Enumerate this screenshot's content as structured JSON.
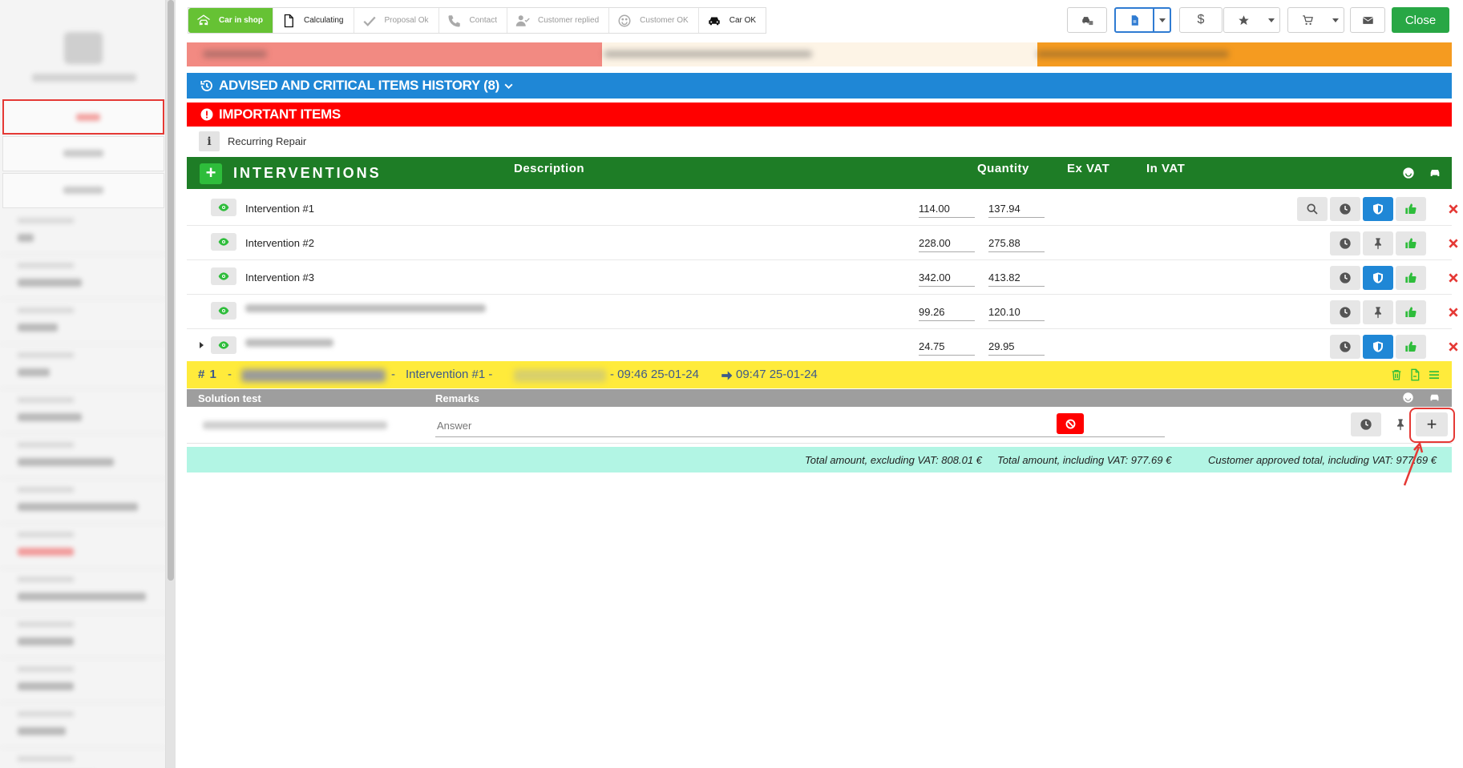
{
  "steps": [
    {
      "label": "Car in shop",
      "state": "done",
      "icon": "car-garage-icon"
    },
    {
      "label": "Calculating",
      "state": "current",
      "icon": "document-icon"
    },
    {
      "label": "Proposal Ok",
      "state": "muted",
      "icon": "check-icon"
    },
    {
      "label": "Contact",
      "state": "muted",
      "icon": "phone-icon"
    },
    {
      "label": "Customer replied",
      "state": "muted",
      "icon": "user-check-icon"
    },
    {
      "label": "Customer OK",
      "state": "muted",
      "icon": "smile-icon"
    },
    {
      "label": "Car OK",
      "state": "current",
      "icon": "car-icon"
    }
  ],
  "toolbar": {
    "close_label": "Close",
    "dollar_label": "$"
  },
  "sections": {
    "history_label": "ADVISED AND CRITICAL ITEMS HISTORY (8)",
    "important_label": "IMPORTANT ITEMS",
    "recurring_label": "Recurring Repair",
    "info_label": "i"
  },
  "interventions": {
    "title": "INTERVENTIONS",
    "add_label": "+",
    "col_description": "Description",
    "col_quantity": "Quantity",
    "col_exvat": "Ex VAT",
    "col_invat": "In VAT",
    "rows": [
      {
        "name": "Intervention #1",
        "ex_vat": "114.00",
        "in_vat": "137.94",
        "actions": [
          "search",
          "clock",
          "shield",
          "thumb",
          "delete"
        ]
      },
      {
        "name": "Intervention #2",
        "ex_vat": "228.00",
        "in_vat": "275.88",
        "actions": [
          "clock",
          "pin",
          "thumb",
          "delete"
        ]
      },
      {
        "name": "Intervention #3",
        "ex_vat": "342.00",
        "in_vat": "413.82",
        "actions": [
          "clock",
          "shield",
          "thumb",
          "delete"
        ]
      },
      {
        "name": "",
        "ex_vat": "99.26",
        "in_vat": "120.10",
        "actions": [
          "clock",
          "pin",
          "thumb",
          "delete"
        ]
      },
      {
        "name": "",
        "ex_vat": "24.75",
        "in_vat": "29.95",
        "actions": [
          "clock",
          "shield",
          "thumb",
          "delete"
        ]
      }
    ]
  },
  "solution": {
    "number": "# 1",
    "dash1": "-",
    "dash2": "-",
    "intervention_label": "Intervention #1 -",
    "start": "- 09:46 25-01-24",
    "end": "09:47 25-01-24",
    "col_solution": "Solution test",
    "col_remarks": "Remarks",
    "answer_placeholder": "Answer",
    "add_label": "+"
  },
  "totals": {
    "excl": "Total amount, excluding VAT: 808.01 €",
    "incl": "Total amount, including VAT: 977.69 €",
    "approved": "Customer approved total, including VAT: 977.69 €"
  },
  "colors": {
    "green": "#1e7d26",
    "blue": "#1f87d6",
    "red": "#ff0000",
    "yellow": "#ffeb3b",
    "mint": "#b2f5e4"
  }
}
